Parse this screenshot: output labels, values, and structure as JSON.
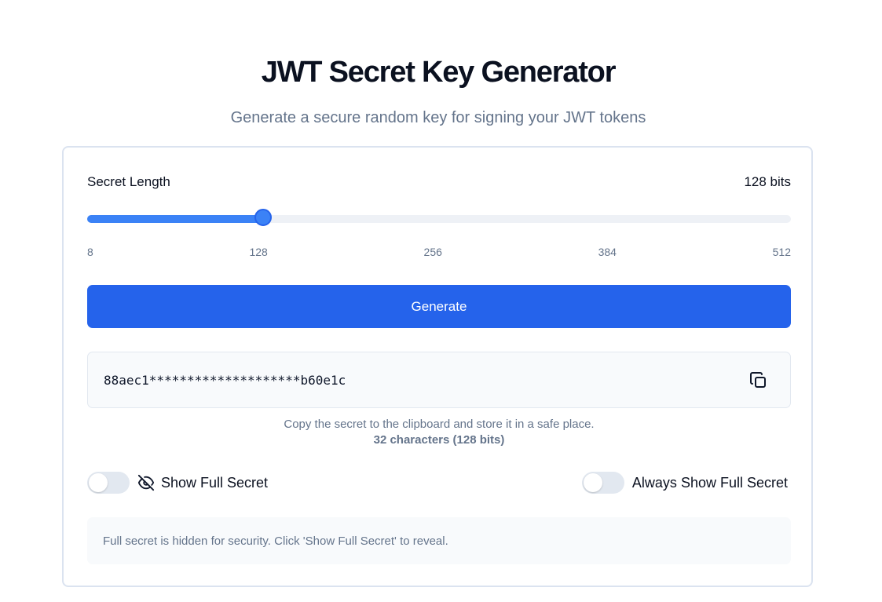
{
  "header": {
    "title": "JWT Secret Key Generator",
    "subtitle": "Generate a secure random key for signing your JWT tokens"
  },
  "length": {
    "label": "Secret Length",
    "value_label": "128 bits",
    "value": 128,
    "min": 8,
    "max": 512,
    "ticks": [
      "8",
      "128",
      "256",
      "384",
      "512"
    ]
  },
  "generate": {
    "label": "Generate"
  },
  "secret": {
    "masked": "88aec1********************b60e1c",
    "copy_icon": "copy-icon"
  },
  "hint": {
    "text": "Copy the secret to the clipboard and store it in a safe place.",
    "count": "32 characters (128 bits)"
  },
  "toggles": {
    "show_full": {
      "label": "Show Full Secret",
      "icon": "eye-off-icon",
      "checked": false
    },
    "always_show": {
      "label": "Always Show Full Secret",
      "checked": false
    }
  },
  "notice": {
    "text": "Full secret is hidden for security. Click 'Show Full Secret' to reveal."
  },
  "colors": {
    "accent": "#2563eb",
    "slider": "#3b82f6",
    "muted_text": "#64748b",
    "border": "#dbe3f0"
  }
}
